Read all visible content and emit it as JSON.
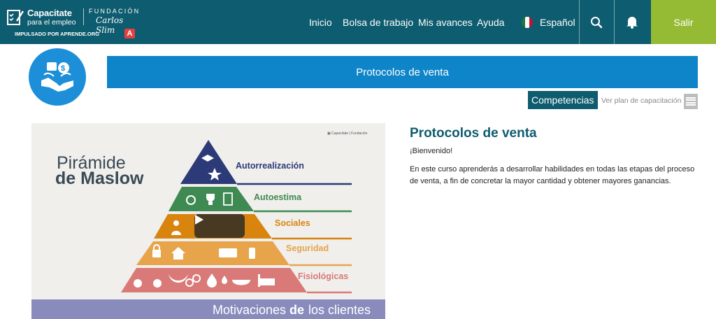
{
  "brand": {
    "title": "Capacitate",
    "subtitle": "para el empleo",
    "foundation": "FUNDACIÓN",
    "signature": "Carlos Slim",
    "powered_by": "IMPULSADO POR APRENDE.ORG",
    "powered_mark": "A"
  },
  "nav": {
    "links": [
      "Inicio",
      "Bolsa de trabajo",
      "Mis avances",
      "Ayuda"
    ],
    "language": "Español",
    "logout_label": "Salir"
  },
  "colors": {
    "nav_bg": "#0e5c6f",
    "logout_bg": "#95bb35",
    "banner_bg": "#0f85c9",
    "course_icon_bg": "#1d8fd8"
  },
  "icons": {
    "brand": "checklist-icon",
    "flag": "mexico-flag-icon",
    "search": "search-icon",
    "notifications": "bell-icon",
    "course": "handshake-icon",
    "plan": "list-icon",
    "play": "play-icon"
  },
  "course": {
    "banner_title": "Protocolos de venta",
    "competencies_label": "Competencias",
    "plan_link": "Ver plan de capacitación"
  },
  "video": {
    "slide_title_line1": "Pirámide",
    "slide_title_line2": "de Maslow",
    "levels": [
      {
        "label": "Autorrealización",
        "color": "#2c3a78"
      },
      {
        "label": "Autoestima",
        "color": "#3f8a52"
      },
      {
        "label": "Sociales",
        "color": "#d9840f"
      },
      {
        "label": "Seguridad",
        "color": "#e8a44b"
      },
      {
        "label": "Fisiológicas",
        "color": "#d97a78"
      }
    ],
    "footer_part1": "Motivaciones",
    "footer_part2": "de",
    "footer_part3": "los clientes"
  },
  "description": {
    "title": "Protocolos de venta",
    "welcome": "¡Bienvenido!",
    "body": "En este curso aprenderás a desarrollar habilidades en todas las etapas del proceso de venta, a fin de concretar la mayor cantidad y obtener mayores ganancias."
  }
}
